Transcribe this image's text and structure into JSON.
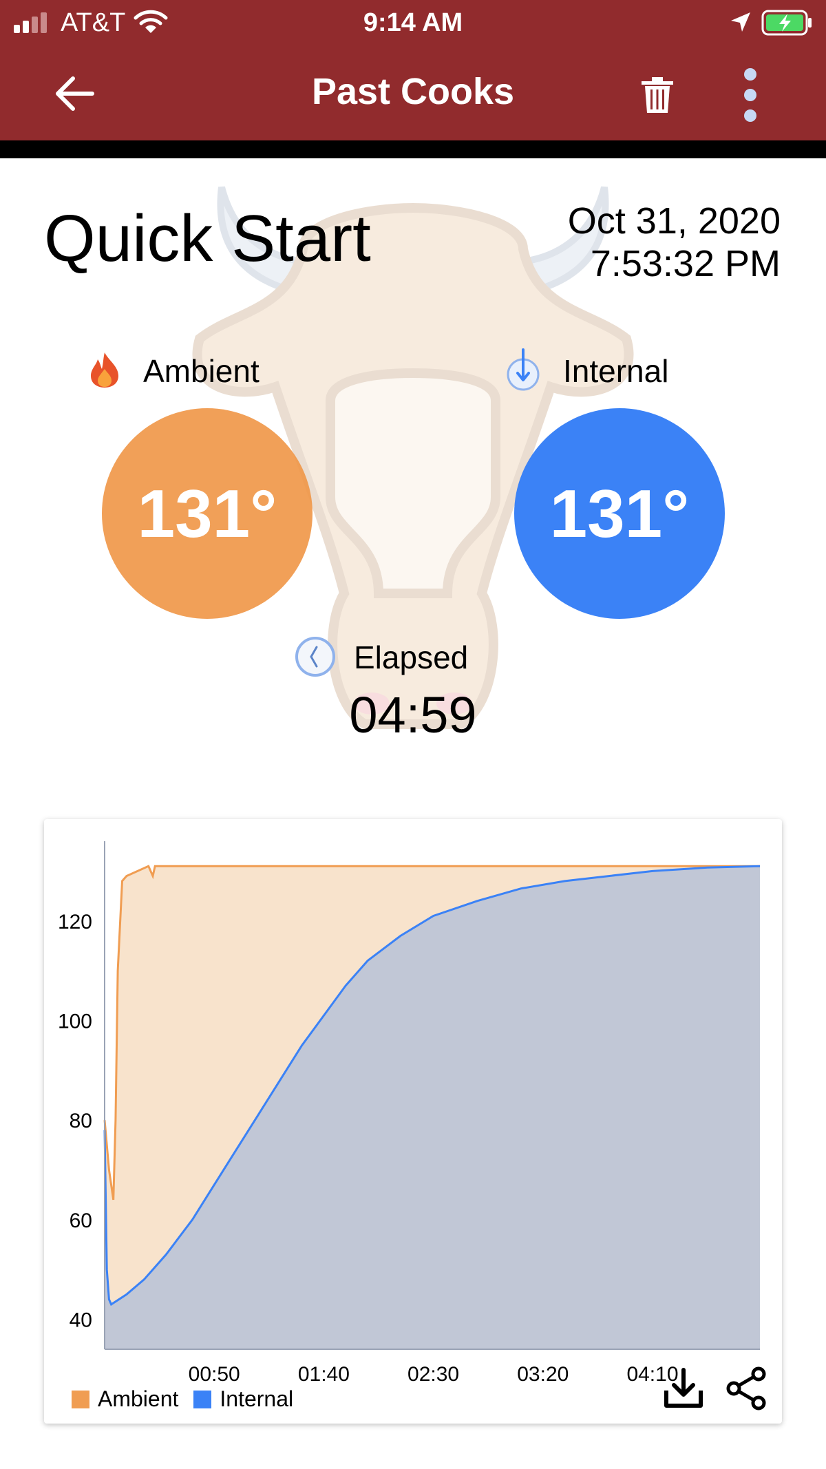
{
  "status_bar": {
    "carrier": "AT&T",
    "time": "9:14 AM"
  },
  "app_bar": {
    "title": "Past Cooks"
  },
  "cook": {
    "name": "Quick Start",
    "date": "Oct 31, 2020",
    "time": "7:53:32 PM",
    "ambient": {
      "label": "Ambient",
      "value": "131°"
    },
    "internal": {
      "label": "Internal",
      "value": "131°"
    },
    "elapsed": {
      "label": "Elapsed",
      "value": "04:59"
    }
  },
  "colors": {
    "brand": "#912b2d",
    "ambient": "#f09d52",
    "internal": "#3b82f6"
  },
  "chart_data": {
    "type": "area",
    "ylim": [
      34,
      136
    ],
    "xlim": [
      0,
      299
    ],
    "y_ticks": [
      "40",
      "60",
      "80",
      "100",
      "120"
    ],
    "y_tick_values": [
      40,
      60,
      80,
      100,
      120
    ],
    "x_tick_values": [
      50,
      100,
      150,
      200,
      250
    ],
    "x_ticks": [
      "00:50",
      "01:40",
      "02:30",
      "03:20",
      "04:10"
    ],
    "legend": [
      "Ambient",
      "Internal"
    ],
    "legend_position": "bottom-left",
    "series": [
      {
        "name": "Ambient",
        "x": [
          0,
          2,
          4,
          5,
          6,
          8,
          10,
          20,
          22,
          23,
          24,
          60,
          120,
          200,
          299
        ],
        "y": [
          80,
          70,
          64,
          80,
          110,
          128,
          129,
          131,
          129,
          131,
          131,
          131,
          131,
          131,
          131
        ]
      },
      {
        "name": "Internal",
        "x": [
          0,
          1,
          2,
          3,
          10,
          18,
          28,
          40,
          50,
          60,
          70,
          80,
          90,
          100,
          110,
          120,
          135,
          150,
          170,
          190,
          210,
          230,
          250,
          275,
          299
        ],
        "y": [
          78,
          50,
          44,
          43,
          45,
          48,
          53,
          60,
          67,
          74,
          81,
          88,
          95,
          101,
          107,
          112,
          117,
          121,
          124,
          126.5,
          128,
          129,
          130,
          130.7,
          131
        ]
      }
    ]
  },
  "icons": {
    "back": "arrow-left-icon",
    "delete": "trash-icon",
    "more": "more-vertical-icon",
    "ambient": "flame-icon",
    "internal": "thermometer-probe-icon",
    "elapsed": "clock-icon",
    "download": "download-icon",
    "share": "share-icon"
  }
}
